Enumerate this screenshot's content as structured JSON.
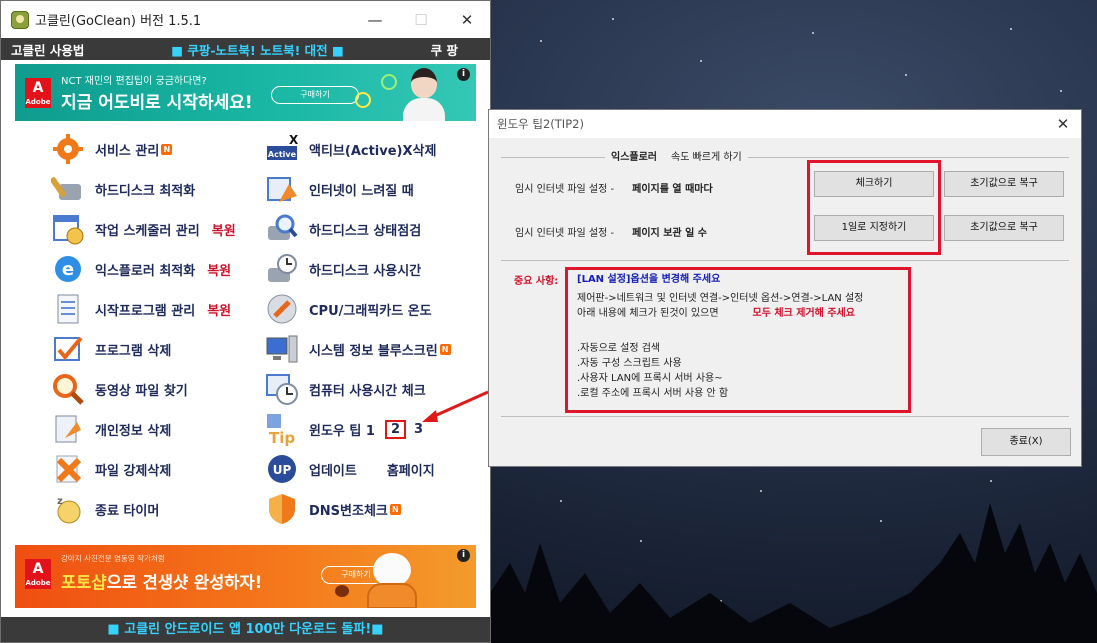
{
  "main_window": {
    "title": "고클린(GoClean) 버전 1.5.1",
    "menu_left": "고클린 사용법",
    "menu_center": "■ 쿠팡-노트북! 노트북! 대전 ■",
    "menu_right": "쿠 팡",
    "top_banner": {
      "small_text": "NCT 재민의 편집팁이 궁금하다면?",
      "big_text": "지금 어도비로 시작하세요!",
      "button": "구매하기",
      "brand": "Adobe",
      "info": "i"
    },
    "bottom_banner": {
      "small_text": "강아지 사진전문 염동영 작가처럼",
      "big_highlight": "포토샵",
      "big_rest": "으로 견생샷 완성하자!",
      "button": "구매하기",
      "brand": "Adobe",
      "info": "i"
    },
    "left_items": [
      {
        "label": "서비스 관리",
        "badge": "N"
      },
      {
        "label": "하드디스크 최적화"
      },
      {
        "label": "작업 스케줄러 관리",
        "extra": "복원"
      },
      {
        "label": "익스플로러 최적화",
        "extra": "복원"
      },
      {
        "label": "시작프로그램 관리",
        "extra": "복원"
      },
      {
        "label": "프로그램 삭제"
      },
      {
        "label": "동영상 파일 찾기"
      },
      {
        "label": "개인정보 삭제"
      },
      {
        "label": "파일 강제삭제"
      },
      {
        "label": "종료 타이머"
      }
    ],
    "right_items": [
      {
        "label": "액티브(Active)X삭제"
      },
      {
        "label": "인터넷이 느려질 때"
      },
      {
        "label": "하드디스크 상태점검"
      },
      {
        "label": "하드디스크 사용시간"
      },
      {
        "label": "CPU/그래픽카드 온도"
      },
      {
        "label": "시스템 정보 블루스크린",
        "badge": "N"
      },
      {
        "label": "컴퓨터 사용시간 체크"
      },
      {
        "label": "윈도우 팁 1",
        "tip2": "2",
        "tip3": "3"
      },
      {
        "label": "업데이트",
        "extra": "홈페이지"
      },
      {
        "label": "DNS변조체크",
        "badge": "N"
      }
    ],
    "icon_text": {
      "active": "Active",
      "tip": "Tip",
      "up": "UP"
    },
    "footer": "■ 고클린 안드로이드 앱 100만 다운로드 돌파!■"
  },
  "tip_window": {
    "title": "윈도우 팁2(TIP2)",
    "group_label_bold": "익스플로러",
    "group_label_rest": "속도 빠르게 하기",
    "row1_label": "임시 인터넷 파일 설정 -",
    "row1_value": "페이지를 열 때마다",
    "row1_button": "체크하기",
    "row1_reset": "초기값으로 복구",
    "row2_label": "임시 인터넷 파일 설정 -",
    "row2_value": "페이지 보관 일 수",
    "row2_button": "1일로 지정하기",
    "row2_reset": "초기값으로 복구",
    "note_title": "중요 사항:",
    "note_heading": "[LAN 설정]옵션을 변경해 주세요",
    "note_line1": "제어판->네트워크 및 인터넷 연결->인터넷 옵션->연결->LAN 설정",
    "note_line2": "아래 내용에 체크가 된것이 있으면",
    "note_line2_red": "모두 체크 제거해 주세요",
    "note_items": [
      ".자동으로 설정 검색",
      ".자동 구성 스크립트 사용",
      ".사용자 LAN에 프록시 서버 사용~",
      ".로컬 주소에 프록시 서버 사용 안 함"
    ],
    "close_button": "종료(X)"
  },
  "colors": {
    "accent_cyan": "#35d2ff",
    "restore_red": "#d1122a",
    "label_navy": "#1e2a5a",
    "highlight_red": "#e0152b"
  }
}
